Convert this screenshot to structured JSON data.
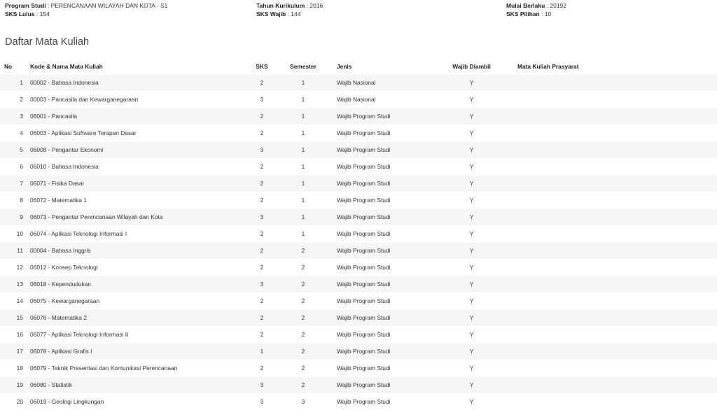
{
  "header": {
    "program_studi_label": "Program Studi",
    "program_studi_value": "PERENCANAAN WILAYAH DAN KOTA - S1",
    "sks_lulus_label": "SKS Lulus",
    "sks_lulus_value": "154",
    "tahun_kurikulum_label": "Tahun Kurikulum",
    "tahun_kurikulum_value": "2016",
    "sks_wajib_label": "SKS Wajib",
    "sks_wajib_value": "144",
    "mulai_berlaku_label": "Mulai Berlaku",
    "mulai_berlaku_value": "20192",
    "sks_pilihan_label": "SKS Pilihan",
    "sks_pilihan_value": "10",
    "separator": " : "
  },
  "section_title": "Daftar Mata Kuliah",
  "table": {
    "headers": {
      "no": "No",
      "kode_nama": "Kode & Nama Mata Kuliah",
      "sks": "SKS",
      "semester": "Semester",
      "jenis": "Jenis",
      "wajib_diambil": "Wajib Diambil",
      "prasyarat": "Mata Kuliah Prasyarat"
    },
    "rows": [
      {
        "no": "1",
        "kode_nama": "00002 - Bahasa Indonesia",
        "sks": "2",
        "semester": "1",
        "jenis": "Wajib Nasional",
        "wajib": "Y",
        "prasyarat": ""
      },
      {
        "no": "2",
        "kode_nama": "00003 - Pancasila dan Kewarganegaraan",
        "sks": "3",
        "semester": "1",
        "jenis": "Wajib Nasional",
        "wajib": "Y",
        "prasyarat": ""
      },
      {
        "no": "3",
        "kode_nama": "06001 - Pancasila",
        "sks": "2",
        "semester": "1",
        "jenis": "Wajib Program Studi",
        "wajib": "Y",
        "prasyarat": ""
      },
      {
        "no": "4",
        "kode_nama": "06003 - Aplikasi Software Terapan Dasar",
        "sks": "2",
        "semester": "1",
        "jenis": "Wajib Program Studi",
        "wajib": "Y",
        "prasyarat": ""
      },
      {
        "no": "5",
        "kode_nama": "06008 - Pengantar Ekonomi",
        "sks": "3",
        "semester": "1",
        "jenis": "Wajib Program Studi",
        "wajib": "Y",
        "prasyarat": ""
      },
      {
        "no": "6",
        "kode_nama": "06010 - Bahasa Indonesia",
        "sks": "2",
        "semester": "1",
        "jenis": "Wajib Program Studi",
        "wajib": "Y",
        "prasyarat": ""
      },
      {
        "no": "7",
        "kode_nama": "06071 - Fisika Dasar",
        "sks": "2",
        "semester": "1",
        "jenis": "Wajib Program Studi",
        "wajib": "Y",
        "prasyarat": ""
      },
      {
        "no": "8",
        "kode_nama": "06072 - Matematika 1",
        "sks": "2",
        "semester": "1",
        "jenis": "Wajib Program Studi",
        "wajib": "Y",
        "prasyarat": ""
      },
      {
        "no": "9",
        "kode_nama": "06073 - Pengantar Perencanaan Wilayah dan Kota",
        "sks": "3",
        "semester": "1",
        "jenis": "Wajib Program Studi",
        "wajib": "Y",
        "prasyarat": ""
      },
      {
        "no": "10",
        "kode_nama": "06074 - Aplikasi Teknologi Informasi I",
        "sks": "2",
        "semester": "1",
        "jenis": "Wajib Program Studi",
        "wajib": "Y",
        "prasyarat": ""
      },
      {
        "no": "11",
        "kode_nama": "00004 - Bahasa Inggris",
        "sks": "2",
        "semester": "2",
        "jenis": "Wajib Program Studi",
        "wajib": "Y",
        "prasyarat": ""
      },
      {
        "no": "12",
        "kode_nama": "06012 - Konsep Teknologi",
        "sks": "2",
        "semester": "2",
        "jenis": "Wajib Program Studi",
        "wajib": "Y",
        "prasyarat": ""
      },
      {
        "no": "13",
        "kode_nama": "06018 - Kependudukan",
        "sks": "3",
        "semester": "2",
        "jenis": "Wajib Program Studi",
        "wajib": "Y",
        "prasyarat": ""
      },
      {
        "no": "14",
        "kode_nama": "06075 - Kewarganegaraan",
        "sks": "2",
        "semester": "2",
        "jenis": "Wajib Program Studi",
        "wajib": "Y",
        "prasyarat": ""
      },
      {
        "no": "15",
        "kode_nama": "06076 - Matematika 2",
        "sks": "2",
        "semester": "2",
        "jenis": "Wajib Program Studi",
        "wajib": "Y",
        "prasyarat": ""
      },
      {
        "no": "16",
        "kode_nama": "06077 - Aplikasi Teknologi Informasi II",
        "sks": "2",
        "semester": "2",
        "jenis": "Wajib Program Studi",
        "wajib": "Y",
        "prasyarat": ""
      },
      {
        "no": "17",
        "kode_nama": "06078 - Aplikasi Grafis I",
        "sks": "1",
        "semester": "2",
        "jenis": "Wajib Program Studi",
        "wajib": "Y",
        "prasyarat": ""
      },
      {
        "no": "18",
        "kode_nama": "06079 - Teknik Presentasi dan Komunikasi Perencanaan",
        "sks": "2",
        "semester": "2",
        "jenis": "Wajib Program Studi",
        "wajib": "Y",
        "prasyarat": ""
      },
      {
        "no": "19",
        "kode_nama": "06080 - Statistik",
        "sks": "3",
        "semester": "2",
        "jenis": "Wajib Program Studi",
        "wajib": "Y",
        "prasyarat": ""
      },
      {
        "no": "20",
        "kode_nama": "06019 - Geologi Lingkungan",
        "sks": "3",
        "semester": "3",
        "jenis": "Wajib Program Studi",
        "wajib": "Y",
        "prasyarat": ""
      }
    ]
  }
}
